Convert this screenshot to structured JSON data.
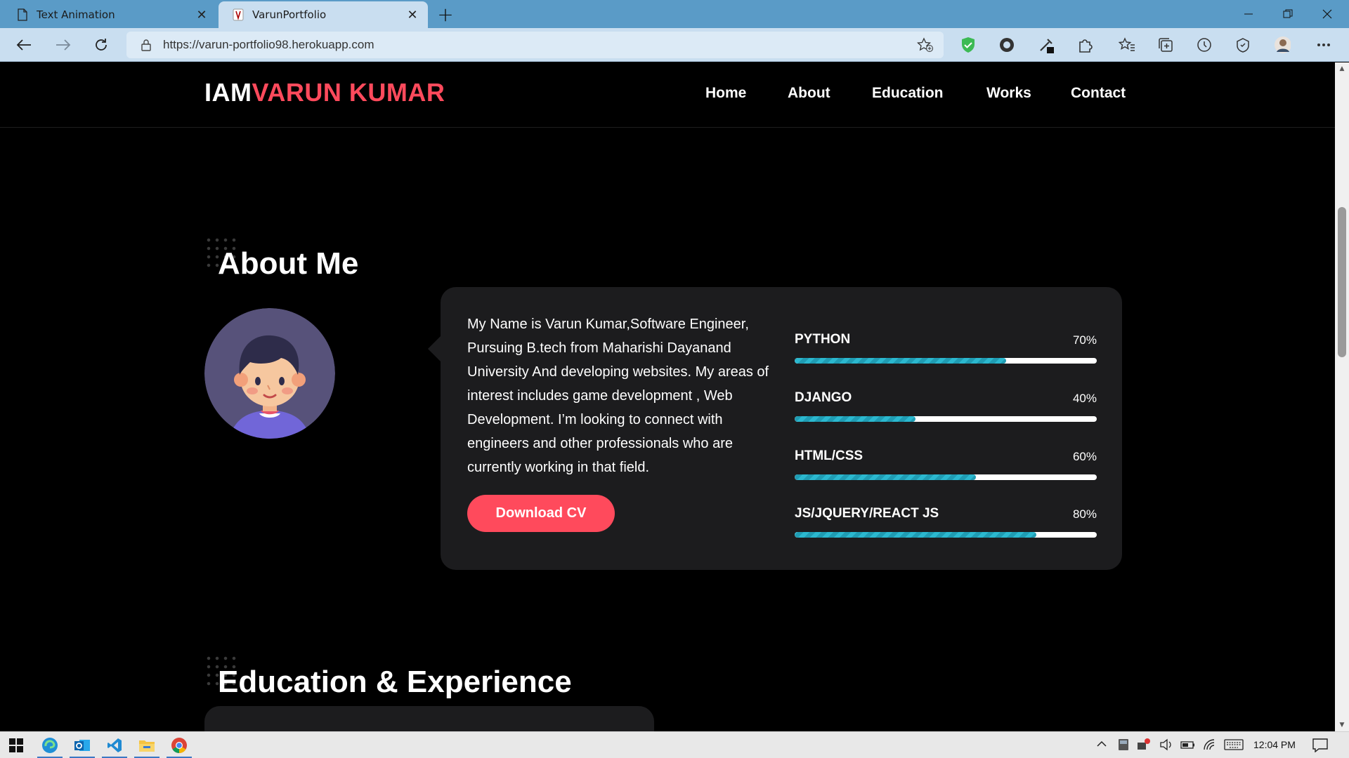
{
  "browser": {
    "tabs": [
      {
        "title": "Text Animation",
        "active": false
      },
      {
        "title": "VarunPortfolio",
        "active": true
      }
    ],
    "url": "https://varun-portfolio98.herokuapp.com"
  },
  "site": {
    "logo_part1": "IAM",
    "logo_part2": "VARUN KUMAR",
    "nav": [
      "Home",
      "About",
      "Education",
      "Works",
      "Contact"
    ]
  },
  "about": {
    "title": "About Me",
    "bio": "My Name is Varun Kumar,Software Engineer, Pursuing B.tech from Maharishi Dayanand University And developing websites. My areas of interest includes game development , Web Development. I’m looking to connect with engineers and other professionals who are currently working in that field.",
    "cv_button": "Download CV",
    "skills": [
      {
        "name": "PYTHON",
        "percent_label": "70%",
        "value": 70
      },
      {
        "name": "DJANGO",
        "percent_label": "40%",
        "value": 40
      },
      {
        "name": "HTML/CSS",
        "percent_label": "60%",
        "value": 60
      },
      {
        "name": "JS/JQUERY/REACT JS",
        "percent_label": "80%",
        "value": 80
      }
    ]
  },
  "education": {
    "title": "Education & Experience"
  },
  "taskbar": {
    "clock": "12:04 PM"
  },
  "colors": {
    "accent": "#ff4a5c",
    "skill_fill": "#1f9cb3",
    "card_bg": "#1c1c1e",
    "chrome_tabstrip": "#5a9bc7",
    "chrome_toolbar": "#c9def0"
  }
}
